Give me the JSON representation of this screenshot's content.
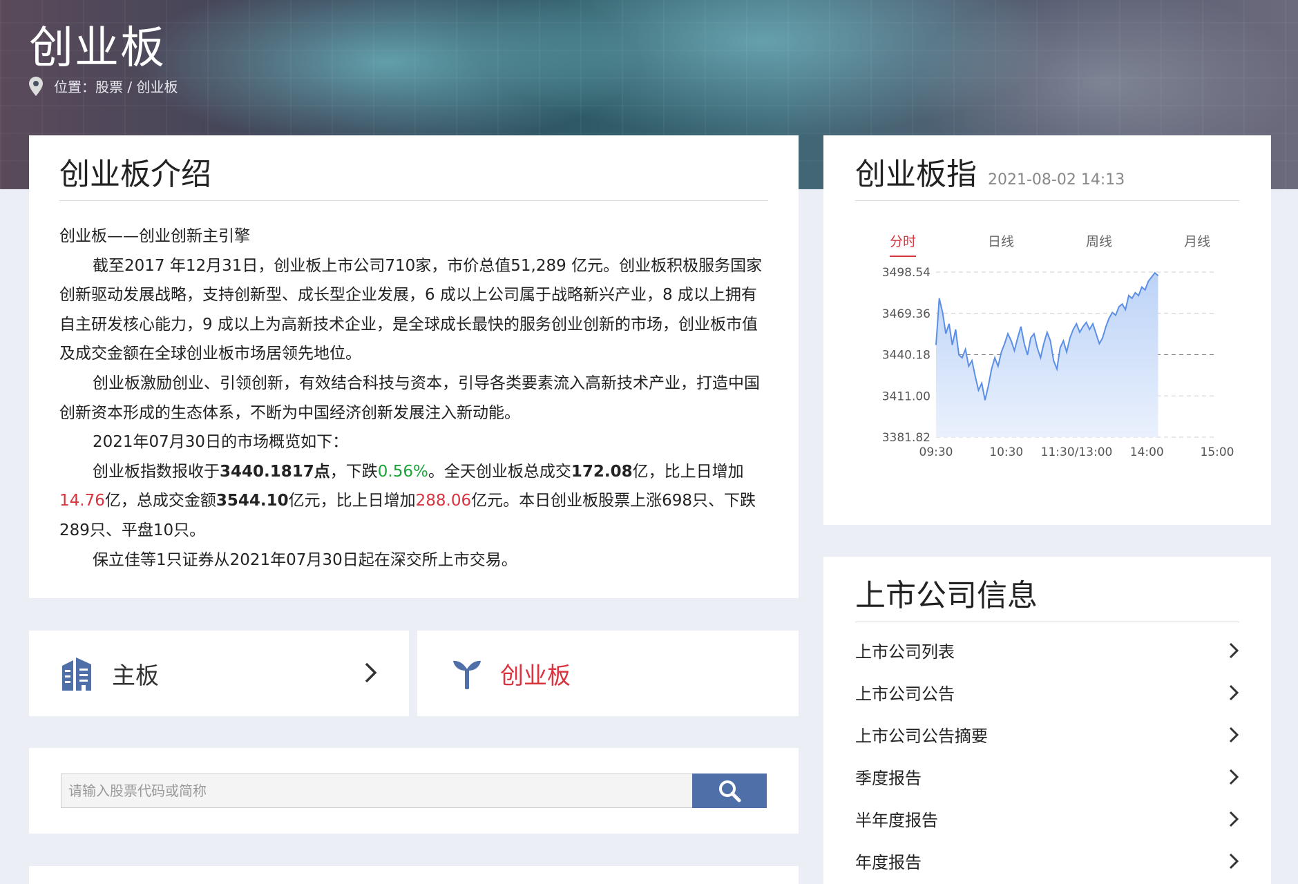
{
  "hero": {
    "title": "创业板",
    "breadcrumb": "位置：股票 / 创业板"
  },
  "intro": {
    "title": "创业板介绍",
    "p1": "创业板——创业创新主引擎",
    "p2": "截至2017 年12月31日，创业板上市公司710家，市价总值51,289 亿元。创业板积极服务国家创新驱动发展战略，支持创新型、成长型企业发展，6 成以上公司属于战略新兴产业，8 成以上拥有自主研发核心能力，9 成以上为高新技术企业，是全球成长最快的服务创业创新的市场，创业板市值及成交金额在全球创业板市场居领先地位。",
    "p3": "创业板激励创业、引领创新，有效结合科技与资本，引导各类要素流入高新技术产业，打造中国创新资本形成的生态体系，不断为中国经济创新发展注入新动能。",
    "p4": "2021年07月30日的市场概览如下：",
    "p5": {
      "t1": "创业板指数报收于",
      "index_close": "3440.1817点",
      "t2": "，下跌",
      "change_pct": "0.56%",
      "t3": "。全天创业板总成交",
      "volume": "172.08",
      "t4": "亿，比上日增加",
      "volume_increase": "14.76",
      "t5": "亿，总成交金额",
      "turnover": "3544.10",
      "t6": "亿元，比上日增加",
      "turnover_increase": "288.06",
      "t7": "亿元。本日创业板股票上涨698只、下跌289只、平盘10只。"
    },
    "p6": "保立佳等1只证券从2021年07月30日起在深交所上市交易。"
  },
  "nav": {
    "main_label": "主板",
    "gem_label": "创业板"
  },
  "search": {
    "placeholder": "请输入股票代码或简称"
  },
  "index_card": {
    "title": "创业板指",
    "time": "2021-08-02 14:13",
    "tabs": [
      "分时",
      "日线",
      "周线",
      "月线"
    ],
    "active_tab": "分时"
  },
  "chart_data": {
    "type": "area",
    "title": "",
    "xlabel": "",
    "ylabel": "",
    "y_ticks": [
      "3498.54",
      "3469.36",
      "3440.18",
      "3411.00",
      "3381.82"
    ],
    "x_ticks": [
      "09:30",
      "10:30",
      "11:30/13:00",
      "14:00",
      "15:00"
    ],
    "ylim": [
      3381.82,
      3498.54
    ],
    "reference_line": 3440.18,
    "series": [
      {
        "values": [
          3447,
          3480,
          3470,
          3455,
          3462,
          3447,
          3458,
          3440,
          3438,
          3444,
          3432,
          3436,
          3425,
          3415,
          3420,
          3408,
          3418,
          3430,
          3438,
          3432,
          3442,
          3448,
          3455,
          3450,
          3443,
          3452,
          3460,
          3448,
          3440,
          3452,
          3455,
          3445,
          3438,
          3448,
          3456,
          3450,
          3436,
          3430,
          3445,
          3450,
          3442,
          3452,
          3458,
          3462,
          3456,
          3460,
          3463,
          3458,
          3462,
          3455,
          3448,
          3452,
          3460,
          3466,
          3470,
          3468,
          3474,
          3476,
          3472,
          3482,
          3480,
          3484,
          3482,
          3488,
          3486,
          3492,
          3495,
          3498,
          3496
        ]
      }
    ],
    "colors": {
      "line": "#5b8fe6",
      "fill_top": "#bcd3f7",
      "fill_bottom": "#eaf1fd"
    }
  },
  "company": {
    "title": "上市公司信息",
    "items": [
      "上市公司列表",
      "上市公司公告",
      "上市公司公告摘要",
      "季度报告",
      "半年度报告",
      "年度报告"
    ]
  },
  "colors": {
    "accent_red": "#d9333f",
    "accent_green": "#1aa53a",
    "search_blue": "#4f6fa8"
  }
}
